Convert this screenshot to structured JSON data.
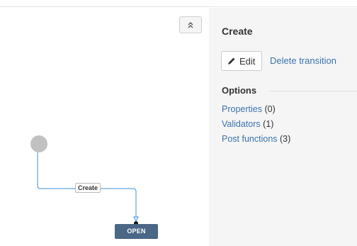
{
  "canvas": {
    "collapse_icon": "double-chevron-up-icon",
    "transition_label": "Create",
    "status_label": "OPEN",
    "initial_node": "initial-circle",
    "colors": {
      "line": "#3b8fd9",
      "status_bg": "#4a6785",
      "initial_node": "#c1c1c1"
    }
  },
  "panel": {
    "title": "Create",
    "edit_label": "Edit",
    "edit_icon": "pencil-icon",
    "delete_label": "Delete transition",
    "options_heading": "Options",
    "options": [
      {
        "link": "Properties",
        "count": "(0)"
      },
      {
        "link": "Validators",
        "count": "(1)"
      },
      {
        "link": "Post functions",
        "count": "(3)"
      }
    ]
  }
}
